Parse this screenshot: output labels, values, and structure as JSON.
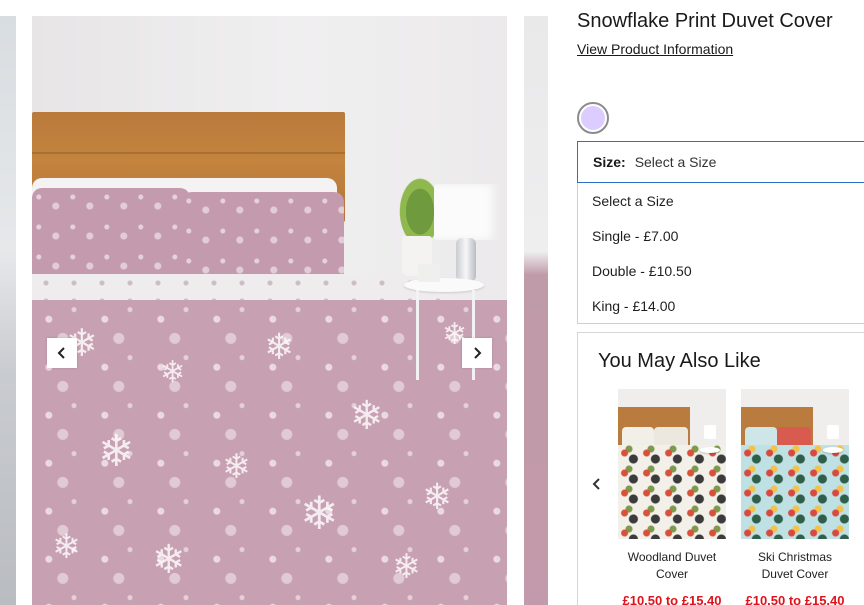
{
  "product": {
    "title": "Snowflake Print Duvet Cover",
    "info_link": "View Product Information"
  },
  "colors": {
    "swatch": "#dcccff",
    "select_border": "#2f6fc7",
    "price": "#e0121b"
  },
  "carousel": {
    "prev_icon": "chevron-left-icon",
    "next_icon": "chevron-right-icon"
  },
  "size": {
    "label": "Size:",
    "selected": "Select a Size",
    "options": [
      "Select a Size",
      "Single - £7.00",
      "Double - £10.50",
      "King - £14.00"
    ]
  },
  "recommendations": {
    "title": "You May Also Like",
    "prev_icon": "chevron-left-icon",
    "items": [
      {
        "name": "Woodland Duvet Cover",
        "price": "£10.50 to £15.40"
      },
      {
        "name": "Ski Christmas Duvet Cover",
        "price": "£10.50 to £15.40"
      }
    ]
  }
}
